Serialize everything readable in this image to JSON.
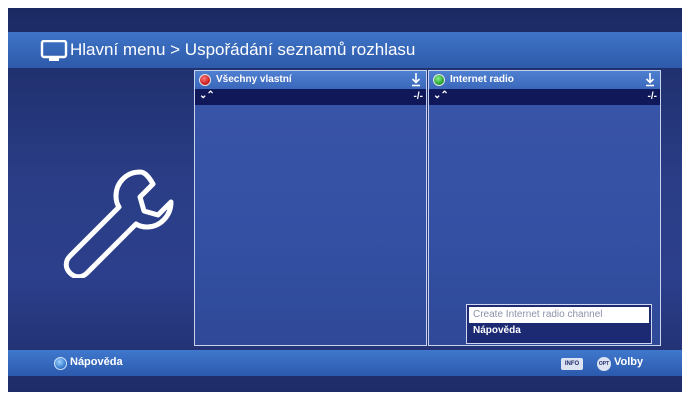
{
  "header": {
    "title": "Hlavní menu > Uspořádání seznamů rozhlasu",
    "icon": "tv-icon"
  },
  "left_panel": {
    "title": "Všechny vlastní",
    "dot_color": "#c21515",
    "sort_controls": "⌄⌃",
    "pager": "-/-"
  },
  "right_panel": {
    "title": "Internet radio",
    "dot_color": "#1d9a2c",
    "sort_controls": "⌄⌃",
    "pager": "-/-"
  },
  "popup_menu": {
    "items": [
      "Create Internet radio channel",
      "Nápověda"
    ]
  },
  "footer": {
    "help_label": "Nápověda",
    "info_badge": "INFO",
    "opt_badge": "OPT",
    "options_label": "Volby"
  },
  "colors": {
    "background": "#2a3d86",
    "header_bar": "#3f74c8",
    "list_subheader": "#10185a"
  }
}
